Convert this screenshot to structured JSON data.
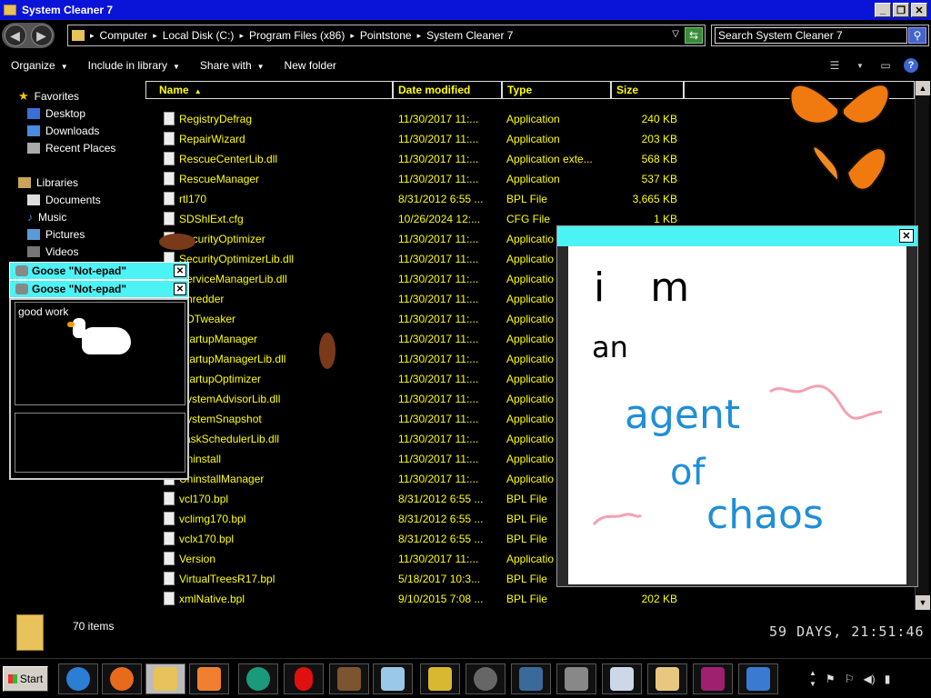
{
  "window": {
    "title": "System Cleaner 7"
  },
  "breadcrumbs": [
    "Computer",
    "Local Disk (C:)",
    "Program Files (x86)",
    "Pointstone",
    "System Cleaner 7"
  ],
  "search": {
    "placeholder": "Search System Cleaner 7"
  },
  "toolbar": {
    "organize": "Organize",
    "include": "Include in library",
    "share": "Share with",
    "new_folder": "New folder"
  },
  "nav": {
    "favorites": "Favorites",
    "desktop": "Desktop",
    "downloads": "Downloads",
    "recent": "Recent Places",
    "libraries": "Libraries",
    "documents": "Documents",
    "music": "Music",
    "pictures": "Pictures",
    "videos": "Videos"
  },
  "columns": {
    "name": "Name",
    "date": "Date modified",
    "type": "Type",
    "size": "Size"
  },
  "files": [
    {
      "name": "RegistryDefrag",
      "date": "11/30/2017 11:...",
      "type": "Application",
      "size": "240 KB"
    },
    {
      "name": "RepairWizard",
      "date": "11/30/2017 11:...",
      "type": "Application",
      "size": "203 KB"
    },
    {
      "name": "RescueCenterLib.dll",
      "date": "11/30/2017 11:...",
      "type": "Application exte...",
      "size": "568 KB"
    },
    {
      "name": "RescueManager",
      "date": "11/30/2017 11:...",
      "type": "Application",
      "size": "537 KB"
    },
    {
      "name": "rtl170",
      "date": "8/31/2012 6:55 ...",
      "type": "BPL File",
      "size": "3,665 KB"
    },
    {
      "name": "SDShlExt.cfg",
      "date": "10/26/2024 12:...",
      "type": "CFG File",
      "size": "1 KB"
    },
    {
      "name": "SecurityOptimizer",
      "date": "11/30/2017 11:...",
      "type": "Applicatio",
      "size": ""
    },
    {
      "name": "SecurityOptimizerLib.dll",
      "date": "11/30/2017 11:...",
      "type": "Applicatio",
      "size": ""
    },
    {
      "name": "ServiceManagerLib.dll",
      "date": "11/30/2017 11:...",
      "type": "Applicatio",
      "size": ""
    },
    {
      "name": "Shredder",
      "date": "11/30/2017 11:...",
      "type": "Applicatio",
      "size": ""
    },
    {
      "name": "SDTweaker",
      "date": "11/30/2017 11:...",
      "type": "Applicatio",
      "size": ""
    },
    {
      "name": "StartupManager",
      "date": "11/30/2017 11:...",
      "type": "Applicatio",
      "size": ""
    },
    {
      "name": "StartupManagerLib.dll",
      "date": "11/30/2017 11:...",
      "type": "Applicatio",
      "size": ""
    },
    {
      "name": "StartupOptimizer",
      "date": "11/30/2017 11:...",
      "type": "Applicatio",
      "size": ""
    },
    {
      "name": "SystemAdvisorLib.dll",
      "date": "11/30/2017 11:...",
      "type": "Applicatio",
      "size": ""
    },
    {
      "name": "SystemSnapshot",
      "date": "11/30/2017 11:...",
      "type": "Applicatio",
      "size": ""
    },
    {
      "name": "TaskSchedulerLib.dll",
      "date": "11/30/2017 11:...",
      "type": "Applicatio",
      "size": ""
    },
    {
      "name": "Uninstall",
      "date": "11/30/2017 11:...",
      "type": "Applicatio",
      "size": ""
    },
    {
      "name": "UninstallManager",
      "date": "11/30/2017 11:...",
      "type": "Applicatio",
      "size": ""
    },
    {
      "name": "vcl170.bpl",
      "date": "8/31/2012 6:55 ...",
      "type": "BPL File",
      "size": ""
    },
    {
      "name": "vclimg170.bpl",
      "date": "8/31/2012 6:55 ...",
      "type": "BPL File",
      "size": ""
    },
    {
      "name": "vclx170.bpl",
      "date": "8/31/2012 6:55 ...",
      "type": "BPL File",
      "size": ""
    },
    {
      "name": "Version",
      "date": "11/30/2017 11:...",
      "type": "Applicatio",
      "size": ""
    },
    {
      "name": "VirtualTreesR17.bpl",
      "date": "5/18/2017 10:3...",
      "type": "BPL File",
      "size": ""
    },
    {
      "name": "xmlNative.bpl",
      "date": "9/10/2015 7:08 ...",
      "type": "BPL File",
      "size": "202 KB"
    }
  ],
  "status": {
    "items": "70 items",
    "clock": "59 DAYS, 21:51:46"
  },
  "goose": {
    "title": "Goose \"Not-epad\"",
    "text": "good work"
  },
  "drawing": {
    "line1": "i m",
    "line2": "an",
    "line3": "agent",
    "line4": "of",
    "line5": "chaos"
  },
  "taskbar": {
    "start": "Start"
  },
  "colors": {
    "title_blue": "#0a14d8",
    "cyan": "#4cf3f5",
    "file_text": "#ffff00"
  }
}
